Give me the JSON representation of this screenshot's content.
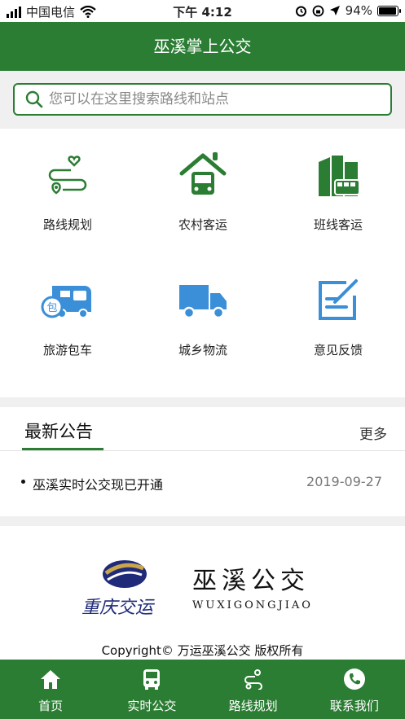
{
  "status_bar": {
    "carrier": "中国电信",
    "time": "下午 4:12",
    "battery": "94%",
    "battery_level": 0.94
  },
  "header": {
    "title": "巫溪掌上公交"
  },
  "search": {
    "placeholder": "您可以在这里搜索路线和站点"
  },
  "grid": {
    "items": [
      {
        "label": "路线规划",
        "icon": "route-plan-icon"
      },
      {
        "label": "农村客运",
        "icon": "rural-bus-icon"
      },
      {
        "label": "班线客运",
        "icon": "shuttle-bus-icon"
      },
      {
        "label": "旅游包车",
        "icon": "tour-charter-icon"
      },
      {
        "label": "城乡物流",
        "icon": "logistics-truck-icon"
      },
      {
        "label": "意见反馈",
        "icon": "feedback-icon"
      }
    ]
  },
  "notice": {
    "title": "最新公告",
    "more": "更多",
    "items": [
      {
        "text": "巫溪实时公交现已开通",
        "date": "2019-09-27"
      }
    ]
  },
  "footer": {
    "brand": "巫溪公交",
    "brand_en": "WUXIGONGJIAO",
    "script": "重庆交运",
    "copyright": "Copyright© 万运巫溪公交 版权所有"
  },
  "tabbar": {
    "items": [
      {
        "label": "首页",
        "icon": "home-icon"
      },
      {
        "label": "实时公交",
        "icon": "bus-icon"
      },
      {
        "label": "路线规划",
        "icon": "route-icon"
      },
      {
        "label": "联系我们",
        "icon": "phone-icon"
      }
    ]
  },
  "colors": {
    "primary": "#2b7d33",
    "accent_blue": "#3a8fd8",
    "background": "#f0f0f0"
  }
}
